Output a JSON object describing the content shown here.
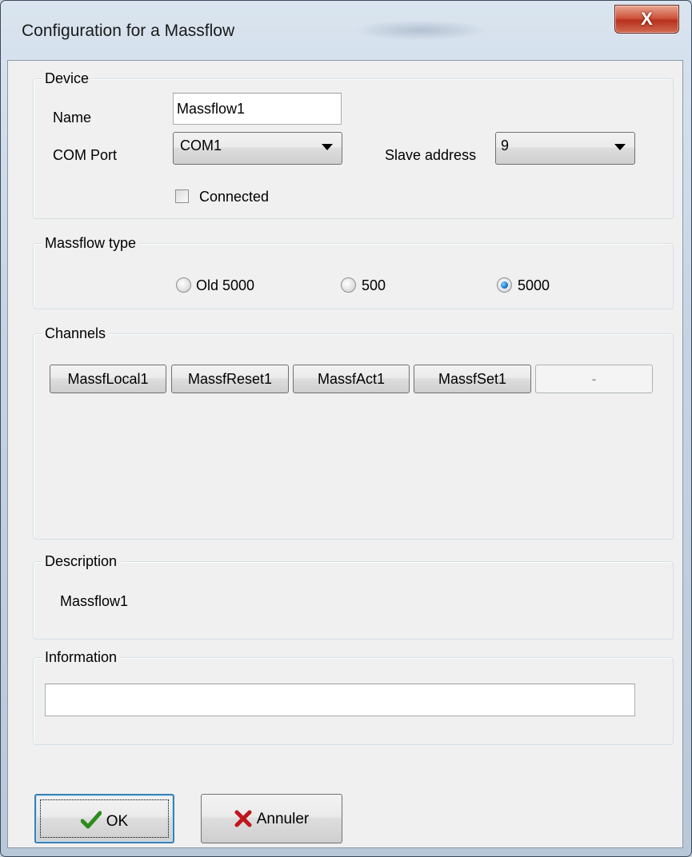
{
  "window": {
    "title": "Configuration for a Massflow",
    "close_label": "X"
  },
  "device": {
    "legend": "Device",
    "name_label": "Name",
    "name_value": "Massflow1",
    "com_port_label": "COM Port",
    "com_port_value": "COM1",
    "slave_address_label": "Slave address",
    "slave_address_value": "9",
    "connected_label": "Connected",
    "connected_checked": false
  },
  "massflow_type": {
    "legend": "Massflow type",
    "options": [
      "Old 5000",
      "500",
      "5000"
    ],
    "selected": "5000"
  },
  "channels": {
    "legend": "Channels",
    "buttons": [
      "MassfLocal1",
      "MassfReset1",
      "MassfAct1",
      "MassfSet1",
      "-"
    ]
  },
  "description": {
    "legend": "Description",
    "text": "Massflow1"
  },
  "information": {
    "legend": "Information",
    "value": ""
  },
  "buttons": {
    "ok": "OK",
    "cancel": "Annuler"
  },
  "colors": {
    "accent_focus": "#3c7fb1",
    "ok_icon": "#2e8b1e",
    "cancel_icon": "#c0161c",
    "close": "#c8422c"
  },
  "icons": {
    "ok": "check-icon",
    "cancel": "cross-icon",
    "close": "close-icon"
  }
}
